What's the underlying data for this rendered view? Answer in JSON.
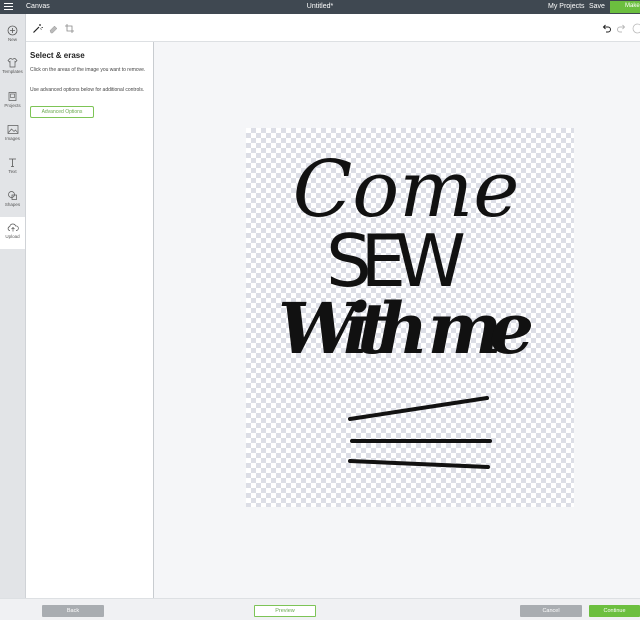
{
  "topbar": {
    "app_name": "Canvas",
    "doc_title": "Untitled*",
    "my_projects": "My Projects",
    "save": "Save",
    "make": "Make"
  },
  "rail": {
    "items": [
      {
        "label": "New",
        "icon": "plus-circle-icon"
      },
      {
        "label": "Templates",
        "icon": "shirt-icon"
      },
      {
        "label": "Projects",
        "icon": "projects-icon"
      },
      {
        "label": "Images",
        "icon": "image-icon"
      },
      {
        "label": "Text",
        "icon": "text-icon"
      },
      {
        "label": "Shapes",
        "icon": "shapes-icon"
      },
      {
        "label": "Upload",
        "icon": "cloud-upload-icon"
      }
    ],
    "active": "Upload"
  },
  "toolbar": {
    "tools": [
      "magic-wand-icon",
      "eraser-icon",
      "crop-icon"
    ],
    "actions": [
      "undo-icon",
      "redo-icon",
      "help-icon"
    ]
  },
  "panel": {
    "title": "Select & erase",
    "instruction1": "Click on the areas of the image you want to remove.",
    "instruction2": "Use advanced options below for additional controls.",
    "advanced_button": "Advanced Options"
  },
  "artwork": {
    "line1": "Come",
    "line2": "SEW",
    "line3": "With me"
  },
  "bottom": {
    "back": "Back",
    "preview": "Preview",
    "cancel": "Cancel",
    "continue": "Continue"
  },
  "colors": {
    "topbar": "#3f4851",
    "accent_green": "#6cbf3f",
    "gray_button": "#a9adb1"
  }
}
